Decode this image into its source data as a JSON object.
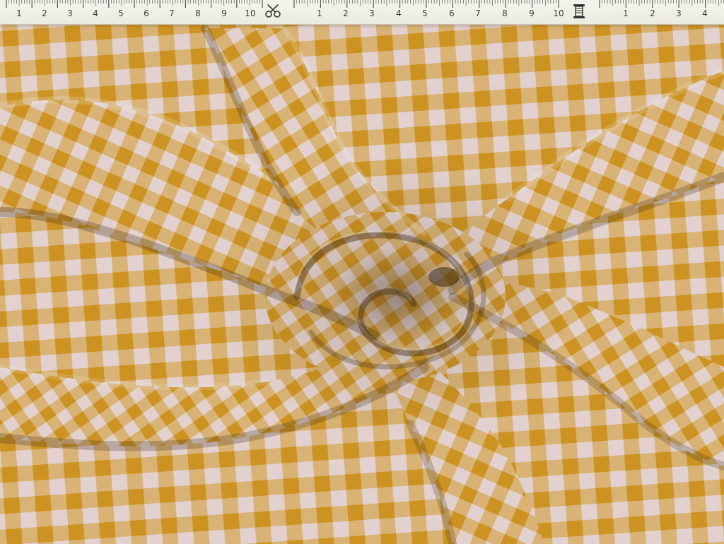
{
  "ruler": {
    "segment_a_numbers": [
      "1",
      "2",
      "3",
      "4",
      "5",
      "6",
      "7",
      "8",
      "9",
      "10"
    ],
    "segment_b_numbers": [
      "1",
      "2",
      "3",
      "4",
      "5",
      "6",
      "7",
      "8",
      "9",
      "10"
    ],
    "segment_c_numbers": [
      "1",
      "2",
      "3",
      "4"
    ],
    "icons": {
      "first_divider": "scissors-icon",
      "second_divider": "thread-spool-icon"
    }
  },
  "fabric": {
    "pattern": "gingham",
    "colors": {
      "mustard": "#d9a12e",
      "pale_pink": "#eddcda",
      "blend": "#d8bf9a"
    }
  }
}
